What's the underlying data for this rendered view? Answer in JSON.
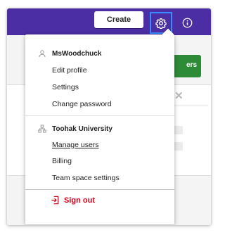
{
  "header": {
    "create_label": "Create"
  },
  "background": {
    "green_button_label": "ers"
  },
  "menu": {
    "user": {
      "name": "MsWoodchuck",
      "items": [
        "Edit profile",
        "Settings",
        "Change password"
      ]
    },
    "org": {
      "name": "Toohak University",
      "items": [
        "Manage users",
        "Billing",
        "Team space settings"
      ]
    },
    "signout_label": "Sign out"
  },
  "colors": {
    "topbar": "#4b2ea3",
    "focus_ring": "#3a8bff",
    "signout": "#d0021b",
    "green_button": "#2d8a37"
  }
}
